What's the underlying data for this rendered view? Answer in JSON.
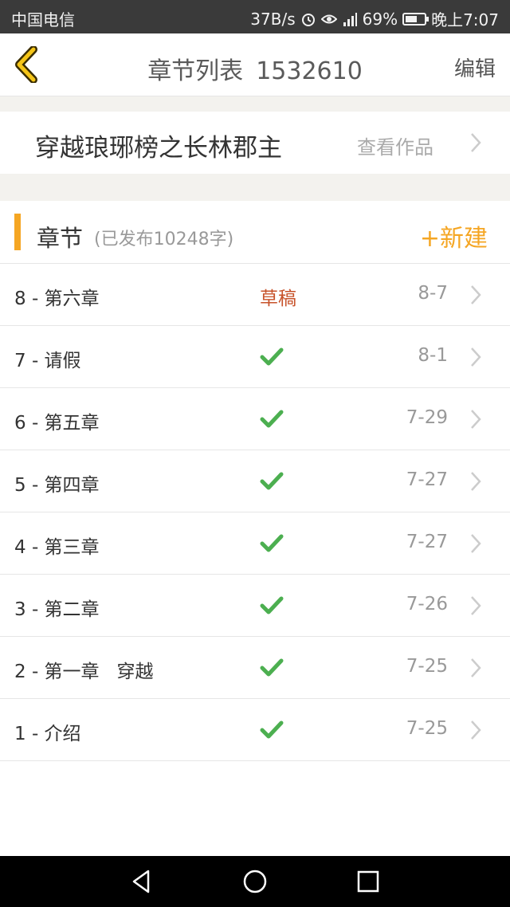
{
  "status_bar": {
    "carrier": "中国电信",
    "speed": "37B/s",
    "network": "4G 2G",
    "battery": "69%",
    "battery_level": 0.69,
    "time": "晚上7:07"
  },
  "header": {
    "title": "章节列表",
    "book_id": "1532610",
    "edit_label": "编辑",
    "back_icon": "chevron-left-icon"
  },
  "work": {
    "title": "穿越琅琊榜之长林郡主",
    "view_label": "查看作品"
  },
  "section": {
    "title": "章节",
    "subtitle": "(已发布10248字)",
    "new_label": "+新建"
  },
  "chapters": [
    {
      "title": "8 - 第六章",
      "status": "草稿",
      "published": false,
      "date": "8-7"
    },
    {
      "title": "7 - 请假",
      "status": "",
      "published": true,
      "date": "8-1"
    },
    {
      "title": "6 - 第五章",
      "status": "",
      "published": true,
      "date": "7-29"
    },
    {
      "title": "5 - 第四章",
      "status": "",
      "published": true,
      "date": "7-27"
    },
    {
      "title": "4 - 第三章",
      "status": "",
      "published": true,
      "date": "7-27"
    },
    {
      "title": "3 - 第二章",
      "status": "",
      "published": true,
      "date": "7-26"
    },
    {
      "title": "2 - 第一章   穿越",
      "status": "",
      "published": true,
      "date": "7-25"
    },
    {
      "title": "1 - 介绍",
      "status": "",
      "published": true,
      "date": "7-25"
    }
  ],
  "colors": {
    "accent": "#f5a623",
    "draft": "#c7522a",
    "check": "#4caf50",
    "background_gap": "#f3f2ee"
  }
}
